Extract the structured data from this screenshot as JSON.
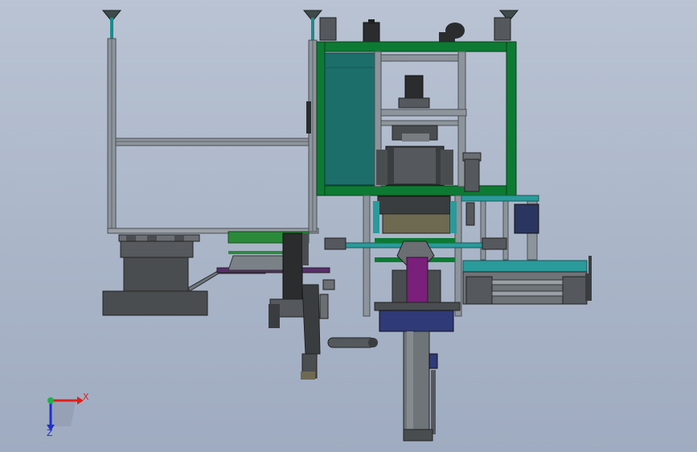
{
  "triad": {
    "x_label": "X",
    "z_label": "Z",
    "x_color": "#e0201a",
    "z_color": "#1f2fd0",
    "y_color": "#1fb14a"
  },
  "palette": {
    "frame_green": "#0d7a33",
    "panel_teal": "#1c6e6a",
    "profile_gray": "#8d949b",
    "dark_metal": "#3a3d40",
    "magenta": "#7a1f7a",
    "navy": "#2f3a78",
    "bright_teal": "#2a9a9a"
  }
}
